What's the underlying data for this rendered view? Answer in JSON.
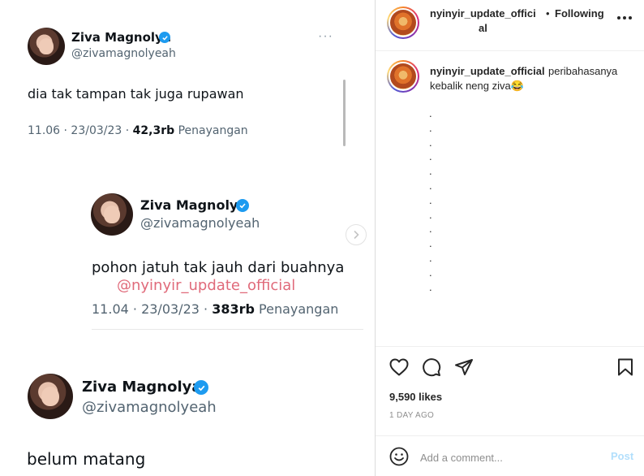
{
  "tweets": [
    {
      "name": "Ziva Magnolya",
      "handle": "@zivamagnolyeah",
      "text": "dia tak tampan tak juga rupawan",
      "time": "11.06 · 23/03/23 · ",
      "views_count": "42,3rb",
      "views_label": " Penayangan"
    },
    {
      "name": "Ziva Magnolya",
      "handle": "@zivamagnolyeah",
      "text": "pohon jatuh tak jauh dari buahnya",
      "mention": "@nyinyir_update_official",
      "time": "11.04 · 23/03/23 · ",
      "views_count": "383rb",
      "views_label": " Penayangan"
    },
    {
      "name": "Ziva Magnolya",
      "handle": "@zivamagnolyeah",
      "text": "belum matang"
    }
  ],
  "header": {
    "username_line1": "nyinyir_update_offici",
    "username_line2": "al",
    "separator": "•",
    "following_label": "Following",
    "menu_icon": "more-horizontal-icon"
  },
  "caption": {
    "username": "nyinyir_update_official",
    "text_line1": "peribahasanya",
    "text_line2": "kebalik neng ziva",
    "emoji": "😂",
    "dots": [
      ".",
      ".",
      ".",
      ".",
      ".",
      ".",
      ".",
      ".",
      ".",
      ".",
      ".",
      ".",
      "."
    ]
  },
  "actions": {
    "like_icon": "heart-icon",
    "comment_icon": "comment-icon",
    "share_icon": "send-icon",
    "save_icon": "bookmark-icon"
  },
  "likes_text": "9,590 likes",
  "time_ago": "1 DAY AGO",
  "comment": {
    "placeholder": "Add a comment...",
    "post_label": "Post"
  },
  "colors": {
    "twitter_blue": "#1d9bf0",
    "mention_pink": "#e06a7a",
    "post_button_disabled": "#b2dffc"
  }
}
